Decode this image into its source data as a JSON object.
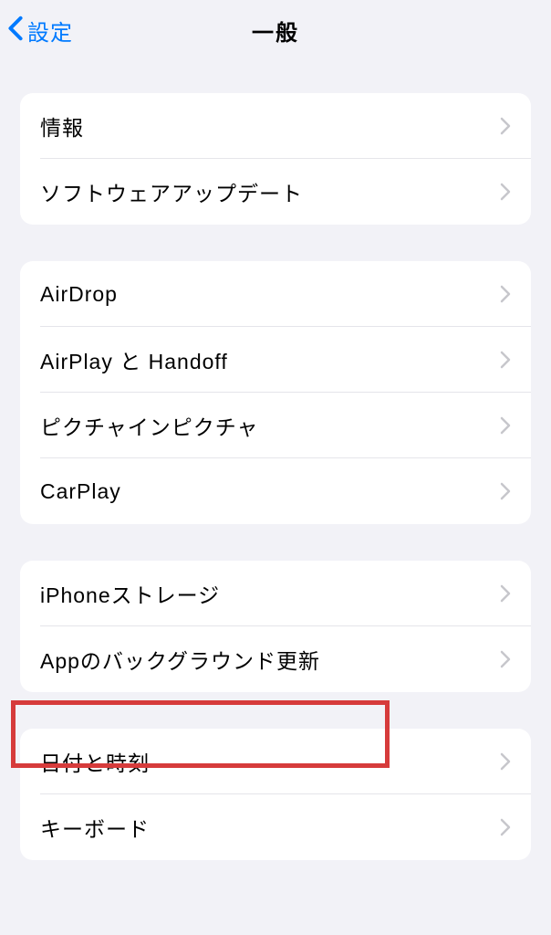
{
  "nav": {
    "back_label": "設定",
    "title": "一般"
  },
  "groups": [
    {
      "items": [
        {
          "label": "情報"
        },
        {
          "label": "ソフトウェアアップデート"
        }
      ]
    },
    {
      "items": [
        {
          "label": "AirDrop"
        },
        {
          "label": "AirPlay と Handoff"
        },
        {
          "label": "ピクチャインピクチャ"
        },
        {
          "label": "CarPlay"
        }
      ]
    },
    {
      "items": [
        {
          "label": "iPhoneストレージ"
        },
        {
          "label": "Appのバックグラウンド更新"
        }
      ]
    },
    {
      "items": [
        {
          "label": "日付と時刻"
        },
        {
          "label": "キーボード"
        }
      ]
    }
  ]
}
